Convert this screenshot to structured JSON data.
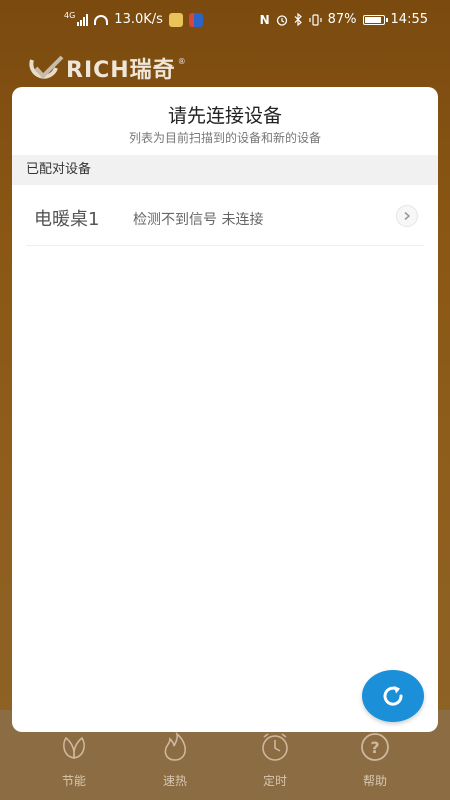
{
  "statusbar": {
    "network": "4G",
    "speed": "13.0K/s",
    "battery": "87%",
    "battery_level": 0.87,
    "time": "14:55"
  },
  "brand": {
    "text": "RICH瑞奇",
    "reg": "®"
  },
  "dialog": {
    "title": "请先连接设备",
    "subtitle": "列表为目前扫描到的设备和新的设备",
    "section_header": "已配对设备",
    "devices": [
      {
        "name": "电暖桌1",
        "status": "检测不到信号 未连接"
      }
    ]
  },
  "bottom_nav": [
    {
      "label": "节能",
      "icon": "leaf-icon"
    },
    {
      "label": "速热",
      "icon": "flame-icon"
    },
    {
      "label": "定时",
      "icon": "clock-icon"
    },
    {
      "label": "帮助",
      "icon": "help-icon"
    }
  ],
  "colors": {
    "accent": "#1b8fd8",
    "background": "#8a5714"
  }
}
